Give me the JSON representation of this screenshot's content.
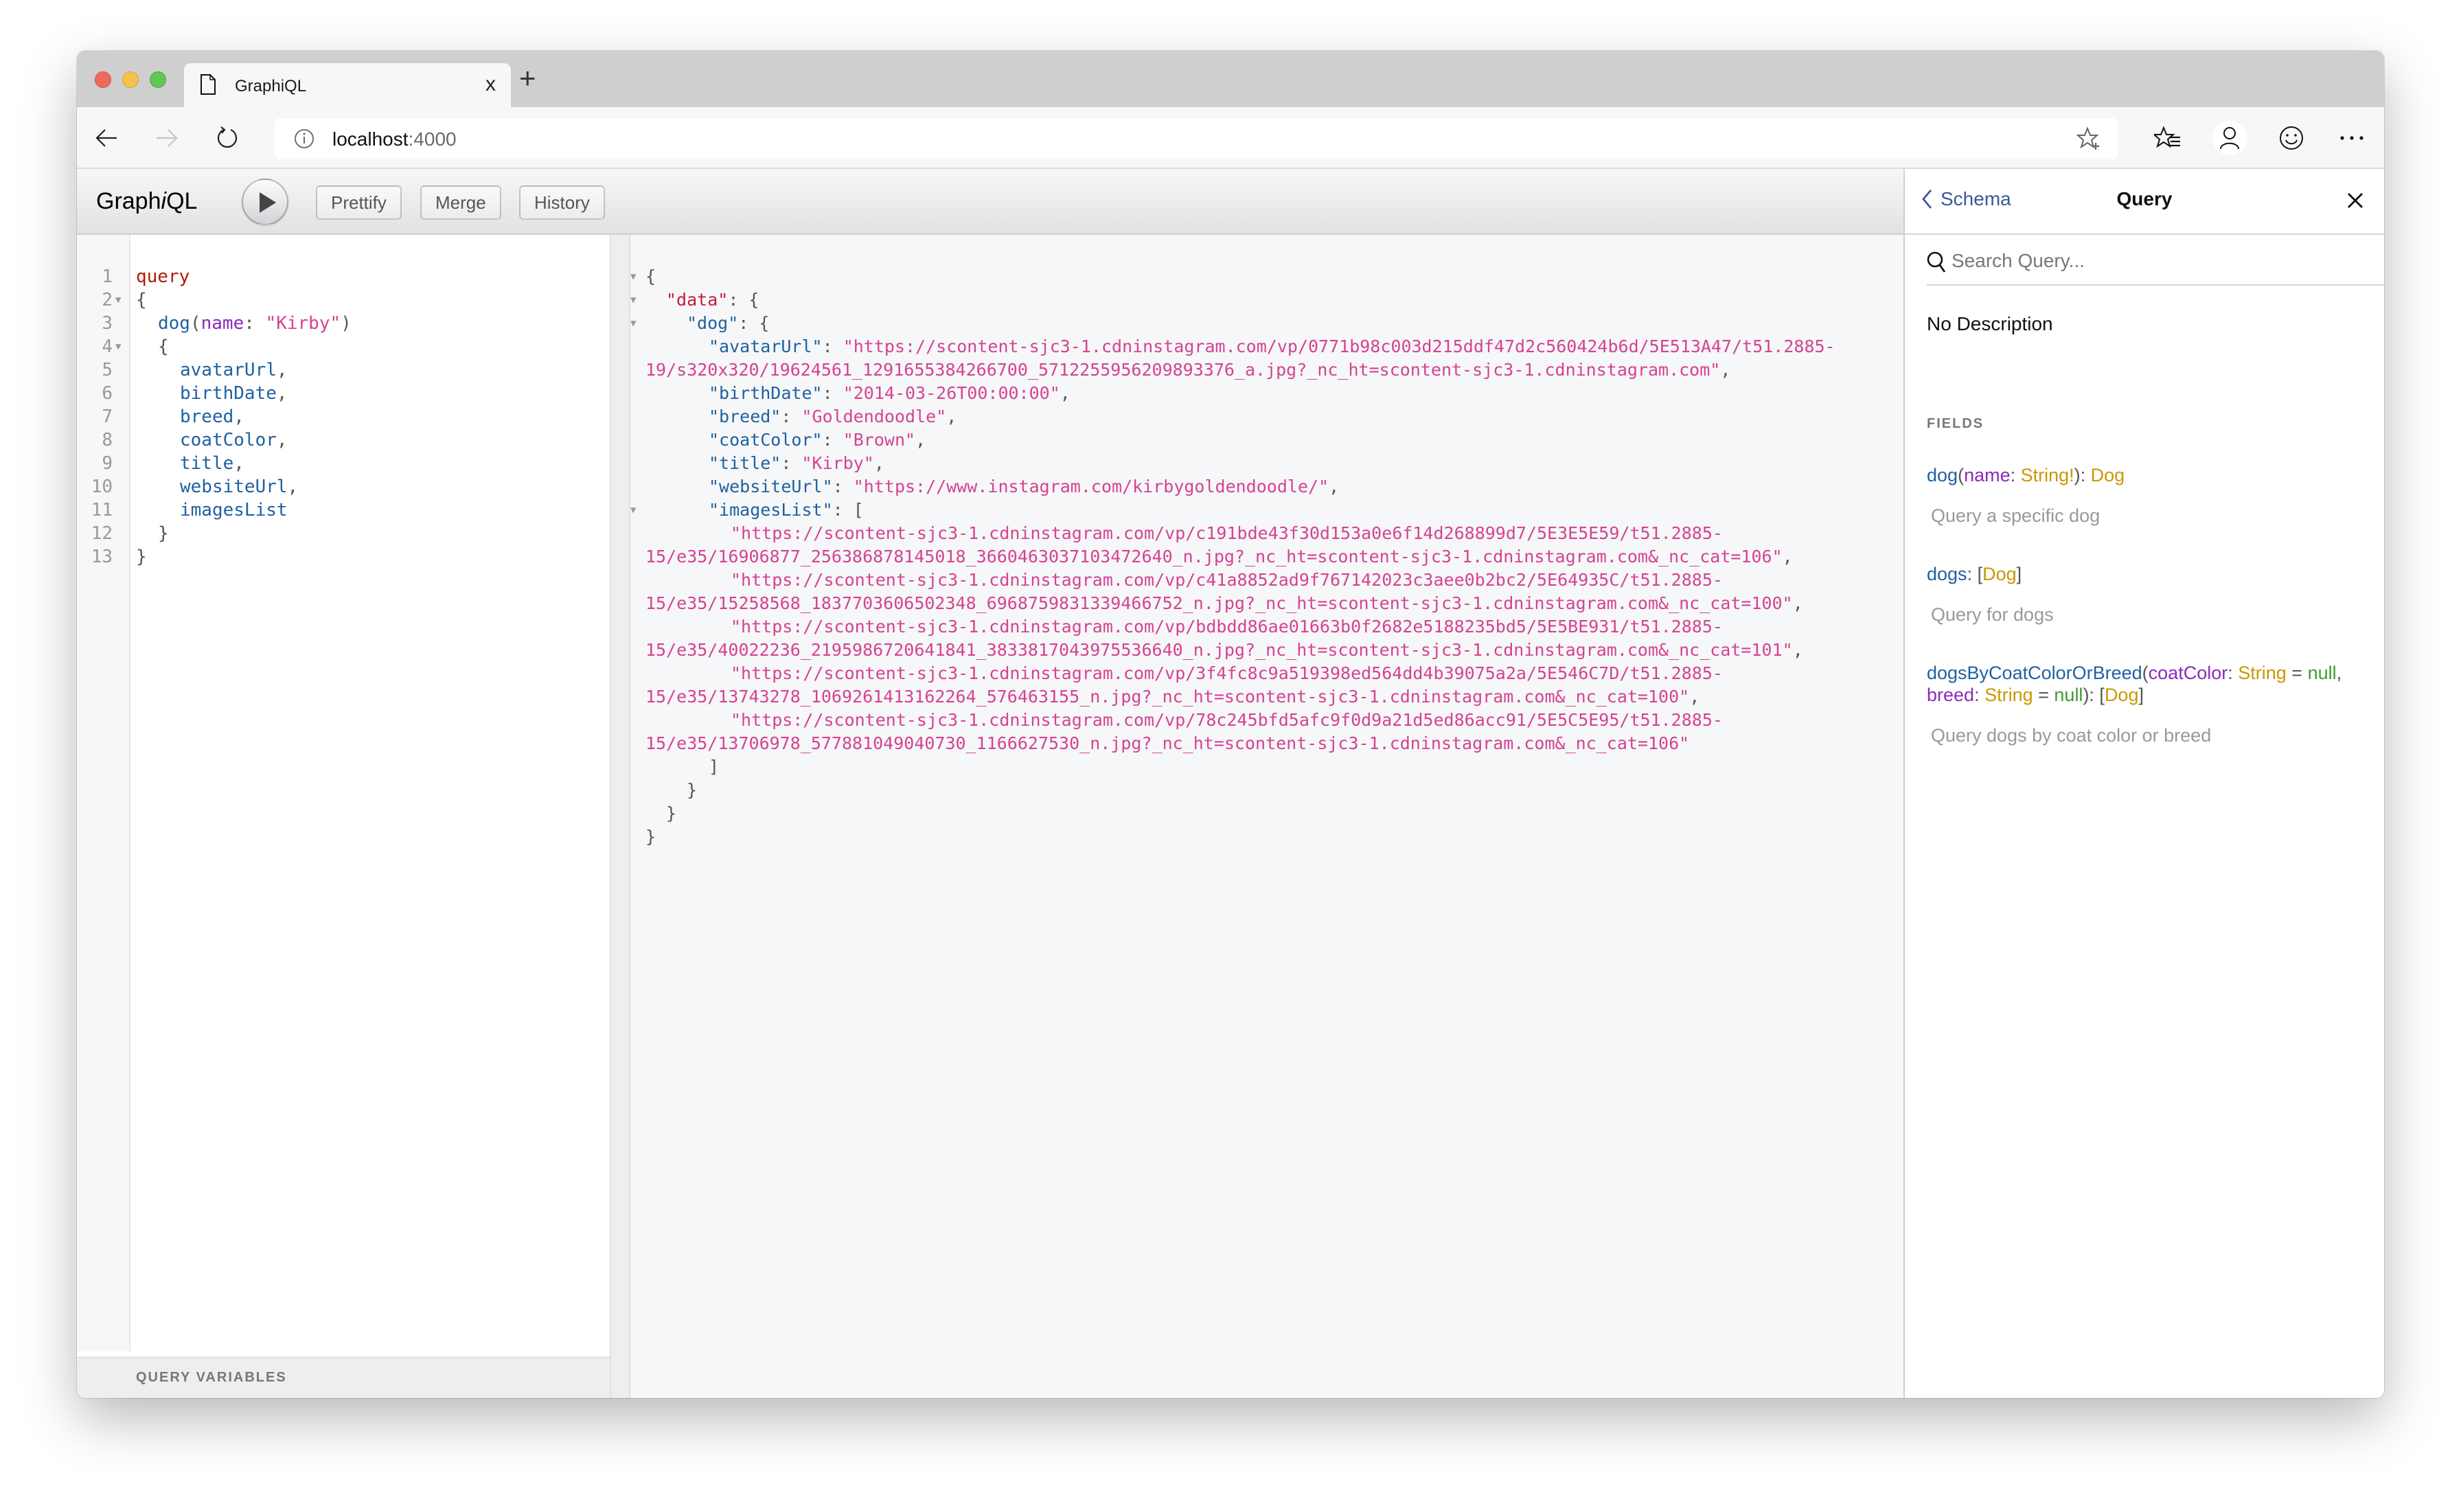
{
  "browser": {
    "tab_title": "GraphiQL",
    "tab_close": "x",
    "new_tab": "+",
    "address_host": "localhost",
    "address_port": ":4000"
  },
  "graphiql": {
    "logo_prefix": "Graph",
    "logo_i": "i",
    "logo_suffix": "QL",
    "buttons": {
      "prettify": "Prettify",
      "merge": "Merge",
      "history": "History"
    },
    "query_variables_label": "QUERY VARIABLES"
  },
  "query_editor": {
    "line_numbers": [
      "1",
      "2",
      "3",
      "4",
      "5",
      "6",
      "7",
      "8",
      "9",
      "10",
      "11",
      "12",
      "13"
    ],
    "keyword": "query",
    "open_brace": "{",
    "close_brace": "}",
    "field_name": "dog",
    "arg_name": "name",
    "arg_value": "\"Kirby\"",
    "fields": [
      "avatarUrl",
      "birthDate",
      "breed",
      "coatColor",
      "title",
      "websiteUrl",
      "imagesList"
    ]
  },
  "result": {
    "data_key": "\"data\"",
    "dog_key": "\"dog\"",
    "avatarUrl_key": "\"avatarUrl\"",
    "avatarUrl_line1": "\"https://scontent-sjc3-1.cdninstagram.com/vp/0771b98c003d215ddf47d2c560424b6d/5E513A47/t51.2885-",
    "avatarUrl_line2": "19/s320x320/19624561_1291655384266700_5712255956209893376_a.jpg?_nc_ht=scontent-sjc3-1.cdninstagram.com\"",
    "birthDate_key": "\"birthDate\"",
    "birthDate": "\"2014-03-26T00:00:00\"",
    "breed_key": "\"breed\"",
    "breed": "\"Goldendoodle\"",
    "coatColor_key": "\"coatColor\"",
    "coatColor": "\"Brown\"",
    "title_key": "\"title\"",
    "title": "\"Kirby\"",
    "websiteUrl_key": "\"websiteUrl\"",
    "websiteUrl": "\"https://www.instagram.com/kirbygoldendoodle/\"",
    "imagesList_key": "\"imagesList\"",
    "images": [
      {
        "line1": "\"https://scontent-sjc3-1.cdninstagram.com/vp/c191bde43f30d153a0e6f14d268899d7/5E3E5E59/t51.2885-",
        "line2": "15/e35/16906877_256386878145018_3660463037103472640_n.jpg?_nc_ht=scontent-sjc3-1.cdninstagram.com&_nc_cat=106\"",
        "comma": ","
      },
      {
        "line1": "\"https://scontent-sjc3-1.cdninstagram.com/vp/c41a8852ad9f767142023c3aee0b2bc2/5E64935C/t51.2885-",
        "line2": "15/e35/15258568_1837703606502348_6968759831339466752_n.jpg?_nc_ht=scontent-sjc3-1.cdninstagram.com&_nc_cat=100\"",
        "comma": ","
      },
      {
        "line1": "\"https://scontent-sjc3-1.cdninstagram.com/vp/bdbdd86ae01663b0f2682e5188235bd5/5E5BE931/t51.2885-",
        "line2": "15/e35/40022236_2195986720641841_3833817043975536640_n.jpg?_nc_ht=scontent-sjc3-1.cdninstagram.com&_nc_cat=101\"",
        "comma": ","
      },
      {
        "line1": "\"https://scontent-sjc3-1.cdninstagram.com/vp/3f4fc8c9a519398ed564dd4b39075a2a/5E546C7D/t51.2885-",
        "line2": "15/e35/13743278_1069261413162264_576463155_n.jpg?_nc_ht=scontent-sjc3-1.cdninstagram.com&_nc_cat=100\"",
        "comma": ","
      },
      {
        "line1": "\"https://scontent-sjc3-1.cdninstagram.com/vp/78c245bfd5afc9f0d9a21d5ed86acc91/5E5C5E95/t51.2885-",
        "line2": "15/e35/13706978_577881049040730_1166627530_n.jpg?_nc_ht=scontent-sjc3-1.cdninstagram.com&_nc_cat=106\"",
        "comma": ""
      }
    ]
  },
  "docs": {
    "back_label": "Schema",
    "title": "Query",
    "search_placeholder": "Search Query...",
    "description": "No Description",
    "section_label": "FIELDS",
    "fields": [
      {
        "name": "dog",
        "args": [
          {
            "name": "name",
            "type": "String!"
          }
        ],
        "return_type": "Dog",
        "description": "Query a specific dog"
      },
      {
        "name": "dogs",
        "return_type": "Dog",
        "return_list": true,
        "description": "Query for dogs"
      },
      {
        "name": "dogsByCoatColorOrBreed",
        "args": [
          {
            "name": "coatColor",
            "type": "String",
            "default": "null"
          },
          {
            "name": "breed",
            "type": "String",
            "default": "null"
          }
        ],
        "return_type": "Dog",
        "return_list": true,
        "description": "Query dogs by coat color or breed"
      }
    ]
  },
  "colors": {
    "keyword": "#b11a04",
    "field": "#1f61a0",
    "argument": "#8b2bb9",
    "string": "#d64292",
    "type": "#ca9800",
    "null_value": "#439a32",
    "link": "#3b5998"
  }
}
